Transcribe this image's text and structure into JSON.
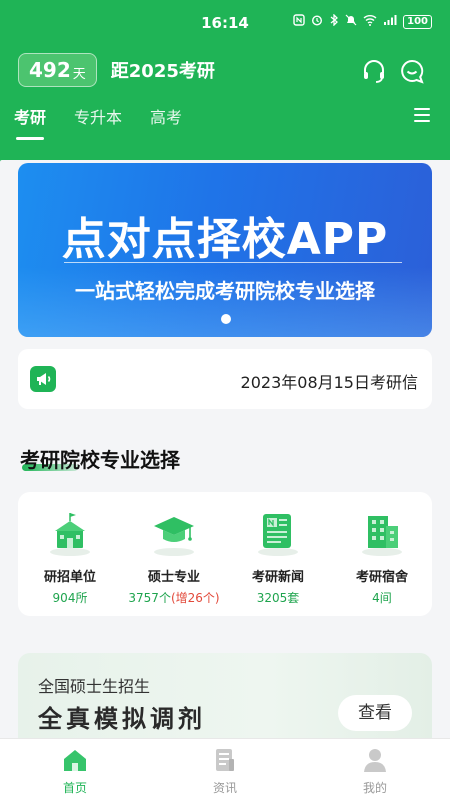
{
  "status_bar": {
    "time": "16:14",
    "battery": "100",
    "icons": [
      "nfc-icon",
      "alarm-icon",
      "bluetooth-icon",
      "mute-icon",
      "wifi-icon",
      "signal-icon",
      "battery-icon"
    ]
  },
  "header": {
    "days_number": "492",
    "days_unit": "天",
    "countdown_title": "距2025考研",
    "icons": [
      "headset-icon",
      "chat-bubble-icon"
    ]
  },
  "tabs": [
    {
      "label": "考研",
      "active": true
    },
    {
      "label": "专升本",
      "active": false
    },
    {
      "label": "高考",
      "active": false
    }
  ],
  "banner": {
    "title": "点对点择校APP",
    "subtitle": "一站式轻松完成考研院校专业选择"
  },
  "notice": {
    "text": "2023年08月15日考研信"
  },
  "section": {
    "title": "考研院校专业选择"
  },
  "categories": [
    {
      "label": "研招单位",
      "value": "904所",
      "extra": "",
      "icon": "school-building-icon"
    },
    {
      "label": "硕士专业",
      "value": "3757个",
      "extra": "(增26个)",
      "icon": "graduation-cap-icon"
    },
    {
      "label": "考研新闻",
      "value": "3205套",
      "extra": "",
      "icon": "newspaper-icon"
    },
    {
      "label": "考研宿舍",
      "value": "4间",
      "extra": "",
      "icon": "dormitory-building-icon"
    }
  ],
  "promo": {
    "subtitle": "全国硕士生招生",
    "title": "全真模拟调剂",
    "button": "查看"
  },
  "bottom_nav": [
    {
      "label": "首页",
      "active": true
    },
    {
      "label": "资讯",
      "active": false
    },
    {
      "label": "我的",
      "active": false
    }
  ],
  "colors": {
    "brand_green": "#1fb456",
    "banner_blue": "#1f74e8",
    "accent_red": "#e24a3b"
  }
}
